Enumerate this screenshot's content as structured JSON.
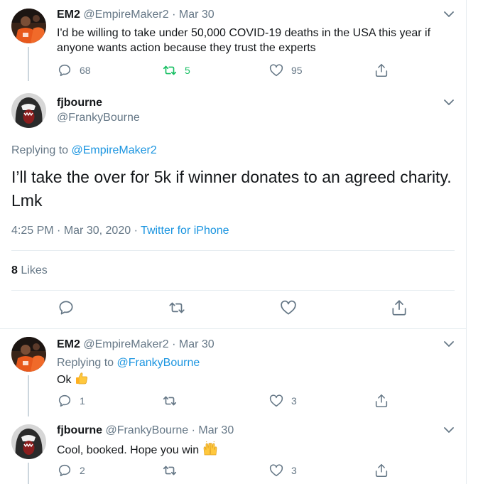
{
  "tweets": [
    {
      "name": "EM2",
      "handle": "@EmpireMaker2",
      "date": "Mar 30",
      "text_lines": [
        "I'd be willing to take under 50,000 COVID-19 deaths in the USA this year if",
        "anyone wants action because they trust the experts"
      ],
      "replies": "68",
      "retweets": "5",
      "likes": "95"
    },
    {
      "name": "EM2",
      "handle": "@EmpireMaker2",
      "date": "Mar 30",
      "replying_label": "Replying to",
      "replying_to": "@FrankyBourne",
      "text": "Ok",
      "replies": "1",
      "retweets": "",
      "likes": "3"
    },
    {
      "name": "fjbourne",
      "handle": "@FrankyBourne",
      "date": "Mar 30",
      "text": "Cool, booked. Hope you win",
      "replies": "2",
      "retweets": "",
      "likes": "3"
    }
  ],
  "main_tweet": {
    "name": "fjbourne",
    "handle": "@FrankyBourne",
    "replying_label": "Replying to",
    "replying_to": "@EmpireMaker2",
    "text": "I’ll take the over for 5k if winner donates to an agreed charity. Lmk",
    "time": "4:25 PM",
    "date": "Mar 30, 2020",
    "source": "Twitter for iPhone",
    "likes_count": "8",
    "likes_label": "Likes"
  },
  "common": {
    "separator": "·"
  },
  "colors": {
    "accent": "#1da1f2",
    "link": "#1b95e0",
    "muted": "#657786",
    "retweet": "#17bf63",
    "border": "#e6ecf0"
  },
  "icons": [
    "reply-icon",
    "retweet-icon",
    "like-icon",
    "share-icon",
    "chevron-down-icon",
    "thumbs-up-emoji",
    "raising-hands-emoji"
  ]
}
